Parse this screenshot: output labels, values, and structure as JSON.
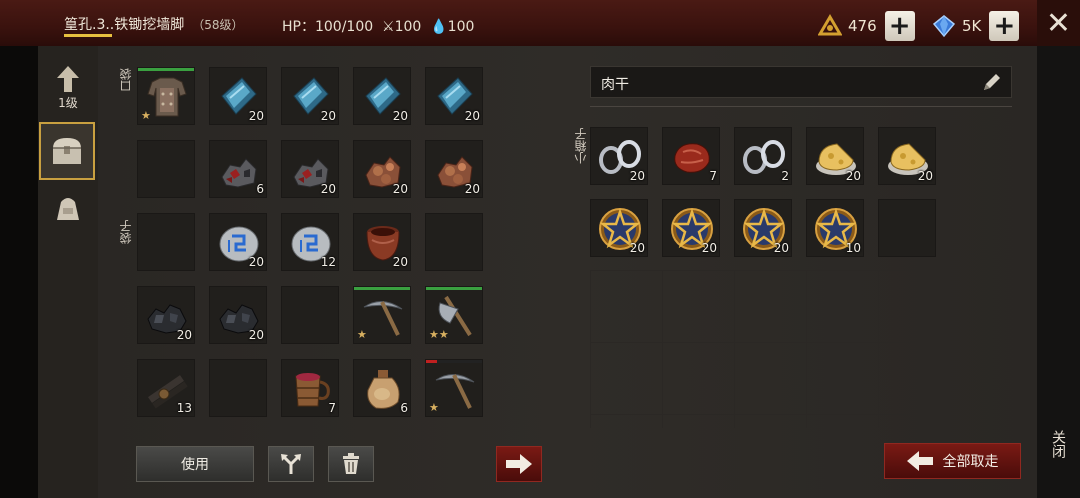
{
  "header": {
    "title": "篁孔.3..铁锄挖墙脚",
    "level": "（58级）",
    "hp": "HP：100/100",
    "attack": "⚔100",
    "water": "💧100",
    "currency1": "476",
    "currency2": "5K",
    "plus": "+",
    "close_x": "✕"
  },
  "sidebar": {
    "up_level": "1级"
  },
  "left_panel": {
    "pocket_label": "口袋",
    "bag_label": "袋子",
    "slots": [
      {
        "icon": "armor-icon",
        "count": "",
        "stars": "★",
        "dur": "green"
      },
      {
        "icon": "ingot-icon",
        "count": "20"
      },
      {
        "icon": "ingot-icon",
        "count": "20"
      },
      {
        "icon": "ingot-icon",
        "count": "20"
      },
      {
        "icon": "ingot-icon",
        "count": "20"
      },
      {
        "icon": "",
        "count": ""
      },
      {
        "icon": "coal-ore-icon",
        "count": "6"
      },
      {
        "icon": "coal-ore-icon",
        "count": "20"
      },
      {
        "icon": "copper-ore-icon",
        "count": "20"
      },
      {
        "icon": "copper-ore-icon",
        "count": "20"
      },
      {
        "icon": "",
        "count": ""
      },
      {
        "icon": "rune-stone-icon",
        "count": "20"
      },
      {
        "icon": "rune-stone-icon",
        "count": "12"
      },
      {
        "icon": "clay-pot-icon",
        "count": "20"
      },
      {
        "icon": "",
        "count": ""
      },
      {
        "icon": "coal-icon",
        "count": "20"
      },
      {
        "icon": "coal-icon",
        "count": "20"
      },
      {
        "icon": "",
        "count": ""
      },
      {
        "icon": "pickaxe-icon",
        "count": "",
        "stars": "★",
        "dur": "green"
      },
      {
        "icon": "axe-icon",
        "count": "",
        "stars": "★★",
        "dur": "green"
      },
      {
        "icon": "log-icon",
        "count": "13"
      },
      {
        "icon": "",
        "count": ""
      },
      {
        "icon": "mug-icon",
        "count": "7"
      },
      {
        "icon": "flask-icon",
        "count": "6"
      },
      {
        "icon": "pickaxe-icon",
        "count": "",
        "stars": "★",
        "dur": "red"
      }
    ]
  },
  "right_panel": {
    "item_name": "肉干",
    "box_label": "小箱子",
    "slots": [
      {
        "icon": "chain-icon",
        "count": "20"
      },
      {
        "icon": "meat-icon",
        "count": "7"
      },
      {
        "icon": "chain-icon",
        "count": "2"
      },
      {
        "icon": "cheese-icon",
        "count": "20"
      },
      {
        "icon": "cheese-icon",
        "count": "20"
      },
      {
        "icon": "pentagram-icon",
        "count": "20"
      },
      {
        "icon": "pentagram-icon",
        "count": "20"
      },
      {
        "icon": "pentagram-icon",
        "count": "20"
      },
      {
        "icon": "pentagram-icon",
        "count": "10"
      },
      {
        "icon": "",
        "count": ""
      }
    ]
  },
  "buttons": {
    "use": "使用",
    "take_all": "全部取走",
    "close": "关闭"
  },
  "colors": {
    "accent_gold": "#c9a040",
    "red_button": "#7a1a14",
    "durability_green": "#3aa040"
  }
}
